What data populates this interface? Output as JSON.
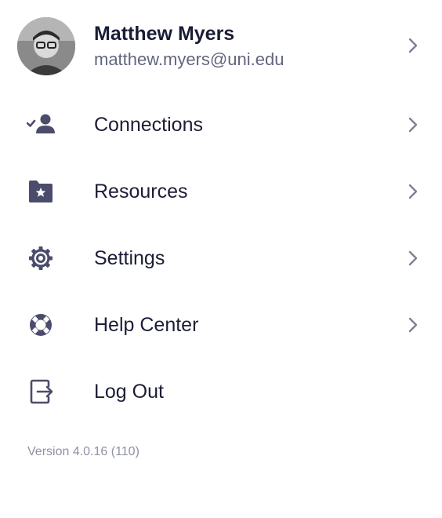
{
  "profile": {
    "name": "Matthew Myers",
    "email": "matthew.myers@uni.edu"
  },
  "menu": {
    "items": [
      {
        "label": "Connections",
        "icon": "connections-icon"
      },
      {
        "label": "Resources",
        "icon": "starred-folder-icon"
      },
      {
        "label": "Settings",
        "icon": "gear-icon"
      },
      {
        "label": "Help Center",
        "icon": "lifebuoy-icon"
      },
      {
        "label": "Log Out",
        "icon": "log-out-icon"
      }
    ]
  },
  "version_text": "Version 4.0.16 (110)",
  "colors": {
    "text": "#1c1d36",
    "secondary_text": "#63657f",
    "icon": "#4b4c6b",
    "chevron": "#7d7f93",
    "version_text": "#8f91a5"
  }
}
